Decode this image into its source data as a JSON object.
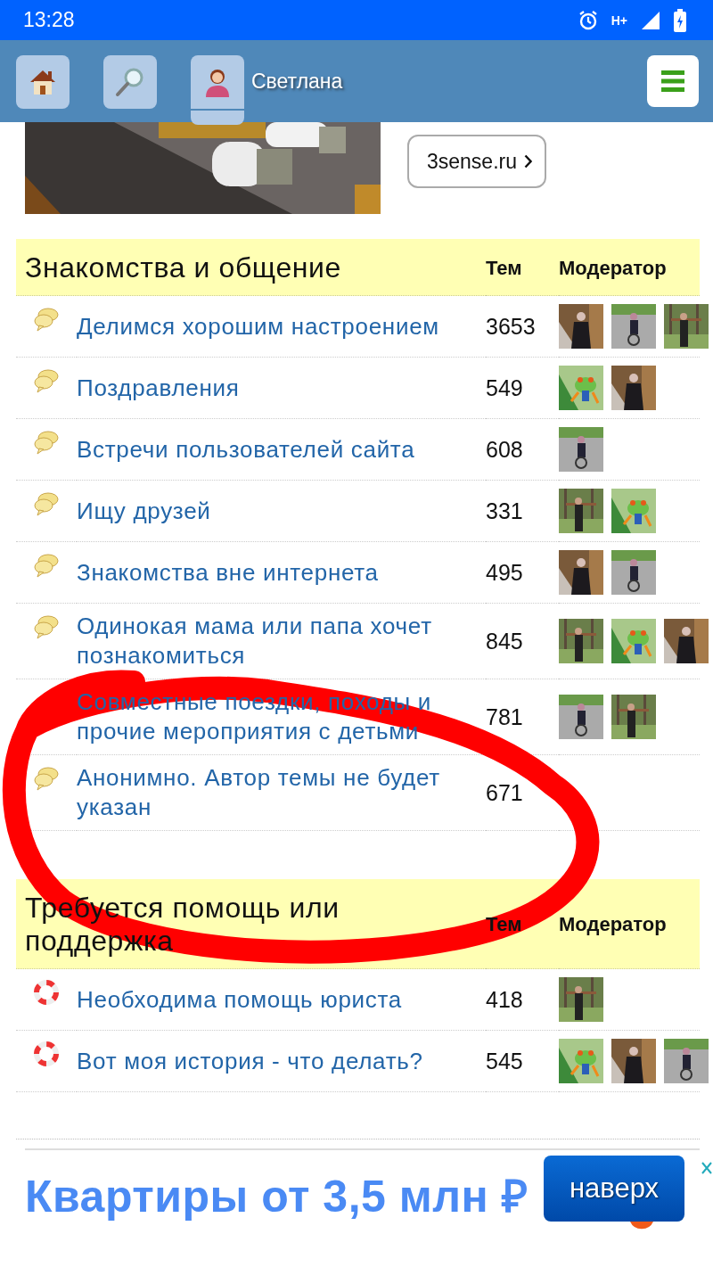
{
  "status_bar": {
    "time": "13:28",
    "network": "H+"
  },
  "header": {
    "user_name": "Светлана"
  },
  "banner": {
    "kind": "picture",
    "link": "3sense.ru"
  },
  "sections": [
    {
      "title": "Знакомства и общение",
      "columns": [
        "Тем",
        "Модератор"
      ],
      "forums": [
        {
          "kind": "chat",
          "title": "Делимся хорошим настроением",
          "topics": "3653"
        },
        {
          "kind": "chat",
          "title": "Поздравления",
          "topics": "549"
        },
        {
          "kind": "chat",
          "title": "Встречи пользователей сайта",
          "topics": "608"
        },
        {
          "kind": "chat",
          "title": "Ищу друзей",
          "topics": "331"
        },
        {
          "kind": "chat",
          "title": "Знакомства вне интернета",
          "topics": "495"
        },
        {
          "kind": "chat",
          "title": "Одинокая мама или папа хочет познакомиться",
          "topics": "845"
        },
        {
          "title": "Совместные поездки, походы и прочие мероприятия с детьми",
          "topics": "781"
        },
        {
          "kind": "chat",
          "title": "Анонимно. Автор темы не будет указан",
          "topics": "671"
        }
      ]
    },
    {
      "title": "Требуется помощь или поддержка",
      "columns": [
        "Тем",
        "Модератор"
      ],
      "forums": [
        {
          "kind": "help",
          "title": "Необходима помощь юриста",
          "topics": "418"
        },
        {
          "kind": "help",
          "title": "Вот моя история - что делать?",
          "topics": "545"
        }
      ]
    }
  ],
  "ad": {
    "headline": "Квартиры от 3,5 млн ₽"
  },
  "scroll_top_button": "наверх",
  "annotation": {
    "kind": "freehand-circle"
  }
}
